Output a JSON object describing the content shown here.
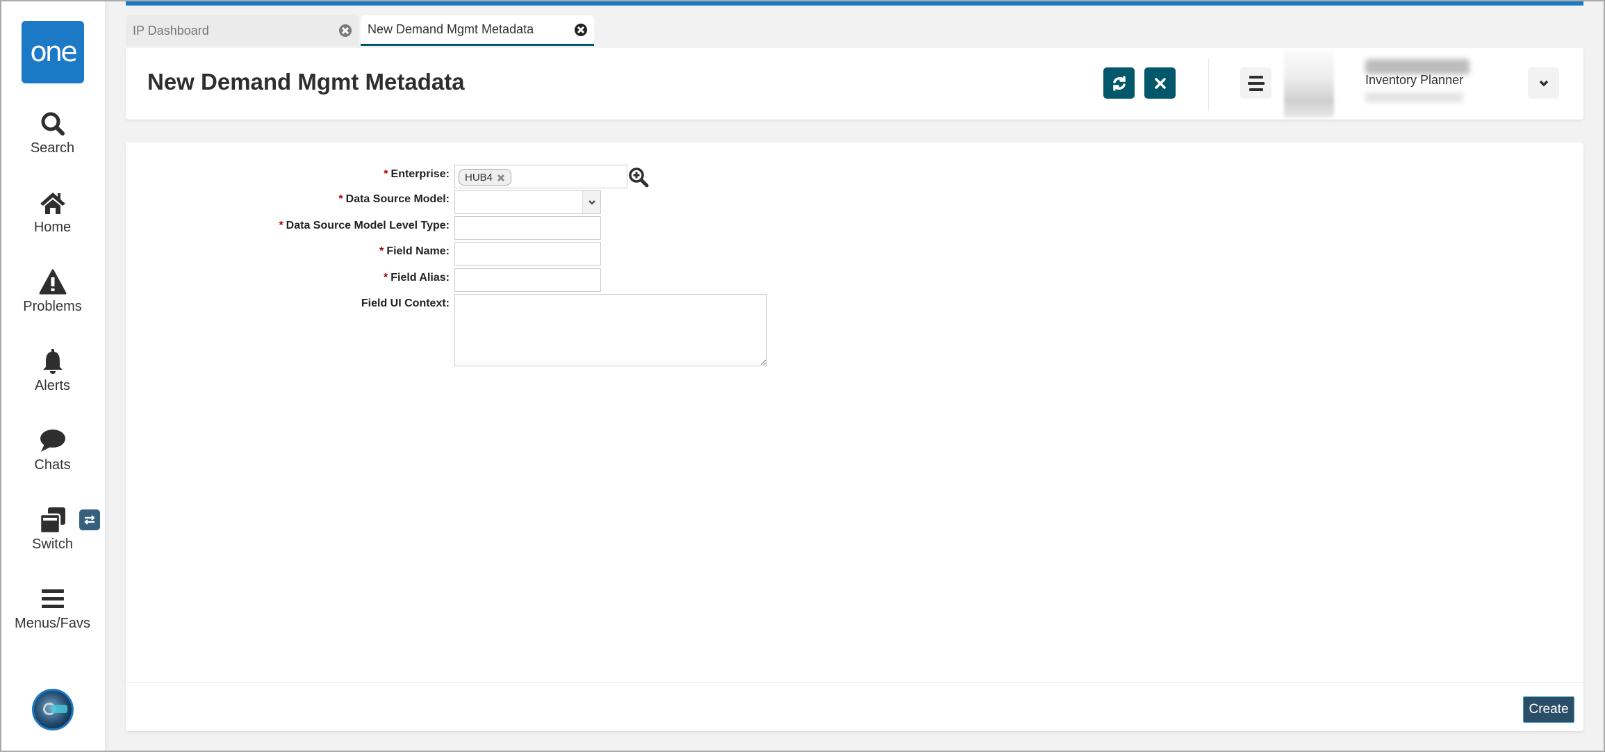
{
  "app": {
    "logo_text": "one",
    "brand_color": "#1b79c6",
    "accent_color": "#02586a"
  },
  "sidebar": {
    "items": [
      {
        "label": "Search",
        "icon": "search-icon"
      },
      {
        "label": "Home",
        "icon": "home-icon"
      },
      {
        "label": "Problems",
        "icon": "warning-icon"
      },
      {
        "label": "Alerts",
        "icon": "bell-icon"
      },
      {
        "label": "Chats",
        "icon": "chat-icon"
      },
      {
        "label": "Switch",
        "icon": "windows-icon"
      },
      {
        "label": "Menus/Favs",
        "icon": "menu-icon"
      }
    ],
    "switch_badge_icon": "exchange-icon",
    "bottom_avatar_icon": "ai-assistant-avatar"
  },
  "tabs": [
    {
      "label": "IP Dashboard",
      "active": false
    },
    {
      "label": "New Demand Mgmt Metadata",
      "active": true
    }
  ],
  "header": {
    "title": "New Demand Mgmt Metadata",
    "refresh_icon": "refresh-icon",
    "close_icon": "close-icon",
    "menu_icon": "hamburger-icon",
    "user": {
      "role": "Inventory Planner"
    },
    "user_dropdown_icon": "chevron-down-icon"
  },
  "form": {
    "fields": [
      {
        "label": "Enterprise:",
        "required": true,
        "type": "lookup",
        "chip": "HUB4",
        "value": ""
      },
      {
        "label": "Data Source Model:",
        "required": true,
        "type": "select",
        "value": ""
      },
      {
        "label": "Data Source Model Level Type:",
        "required": true,
        "type": "text",
        "value": ""
      },
      {
        "label": "Field Name:",
        "required": true,
        "type": "text",
        "value": ""
      },
      {
        "label": "Field Alias:",
        "required": true,
        "type": "text",
        "value": ""
      },
      {
        "label": "Field UI Context:",
        "required": false,
        "type": "textarea",
        "value": ""
      }
    ],
    "required_marker": "*"
  },
  "footer": {
    "create_label": "Create"
  }
}
